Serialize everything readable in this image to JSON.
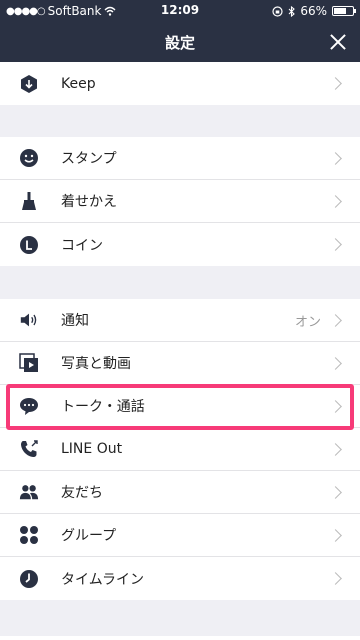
{
  "status_bar": {
    "carrier": "SoftBank",
    "time": "12:09",
    "battery": "66%",
    "battery_level": 0.66
  },
  "header": {
    "title": "設定"
  },
  "sections": [
    {
      "items": [
        {
          "icon": "keep-icon",
          "label": "Keep"
        }
      ]
    },
    {
      "items": [
        {
          "icon": "sticker-icon",
          "label": "スタンプ"
        },
        {
          "icon": "theme-brush-icon",
          "label": "着せかえ"
        },
        {
          "icon": "coin-icon",
          "label": "コイン"
        }
      ]
    },
    {
      "items": [
        {
          "icon": "speaker-icon",
          "label": "通知",
          "value": "オン"
        },
        {
          "icon": "photo-video-icon",
          "label": "写真と動画"
        },
        {
          "icon": "chat-bubble-icon",
          "label": "トーク・通話",
          "highlighted": true
        },
        {
          "icon": "line-out-phone-icon",
          "label": "LINE Out"
        },
        {
          "icon": "friends-icon",
          "label": "友だち"
        },
        {
          "icon": "groups-icon",
          "label": "グループ"
        },
        {
          "icon": "timeline-clock-icon",
          "label": "タイムライン"
        }
      ]
    }
  ],
  "colors": {
    "header_bg": "#2a3143",
    "icon": "#2a3143",
    "highlight": "#f73a78"
  }
}
